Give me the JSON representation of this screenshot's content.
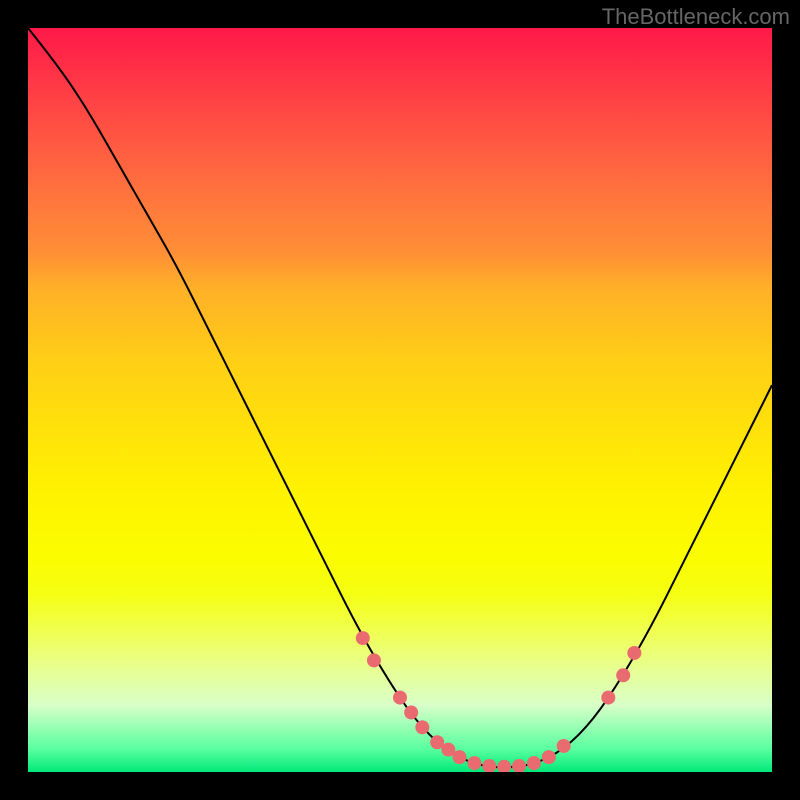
{
  "watermark": "TheBottleneck.com",
  "chart_data": {
    "type": "line",
    "title": "",
    "xlabel": "",
    "ylabel": "",
    "xlim": [
      0,
      100
    ],
    "ylim": [
      0,
      100
    ],
    "curve": [
      {
        "x": 0,
        "y": 100
      },
      {
        "x": 4,
        "y": 95
      },
      {
        "x": 8,
        "y": 89
      },
      {
        "x": 12,
        "y": 82
      },
      {
        "x": 16,
        "y": 75
      },
      {
        "x": 20,
        "y": 68
      },
      {
        "x": 24,
        "y": 60
      },
      {
        "x": 28,
        "y": 52
      },
      {
        "x": 32,
        "y": 44
      },
      {
        "x": 36,
        "y": 36
      },
      {
        "x": 40,
        "y": 28
      },
      {
        "x": 44,
        "y": 20
      },
      {
        "x": 48,
        "y": 13
      },
      {
        "x": 52,
        "y": 7
      },
      {
        "x": 56,
        "y": 3
      },
      {
        "x": 60,
        "y": 1
      },
      {
        "x": 64,
        "y": 0.5
      },
      {
        "x": 68,
        "y": 1
      },
      {
        "x": 72,
        "y": 3
      },
      {
        "x": 76,
        "y": 7
      },
      {
        "x": 80,
        "y": 13
      },
      {
        "x": 84,
        "y": 20
      },
      {
        "x": 88,
        "y": 28
      },
      {
        "x": 92,
        "y": 36
      },
      {
        "x": 96,
        "y": 44
      },
      {
        "x": 100,
        "y": 52
      }
    ],
    "dots": [
      {
        "x": 45,
        "y": 18
      },
      {
        "x": 46.5,
        "y": 15
      },
      {
        "x": 50,
        "y": 10
      },
      {
        "x": 51.5,
        "y": 8
      },
      {
        "x": 53,
        "y": 6
      },
      {
        "x": 55,
        "y": 4
      },
      {
        "x": 56.5,
        "y": 3
      },
      {
        "x": 58,
        "y": 2
      },
      {
        "x": 60,
        "y": 1.2
      },
      {
        "x": 62,
        "y": 0.8
      },
      {
        "x": 64,
        "y": 0.7
      },
      {
        "x": 66,
        "y": 0.8
      },
      {
        "x": 68,
        "y": 1.2
      },
      {
        "x": 70,
        "y": 2
      },
      {
        "x": 72,
        "y": 3.5
      },
      {
        "x": 78,
        "y": 10
      },
      {
        "x": 80,
        "y": 13
      },
      {
        "x": 81.5,
        "y": 16
      }
    ]
  }
}
